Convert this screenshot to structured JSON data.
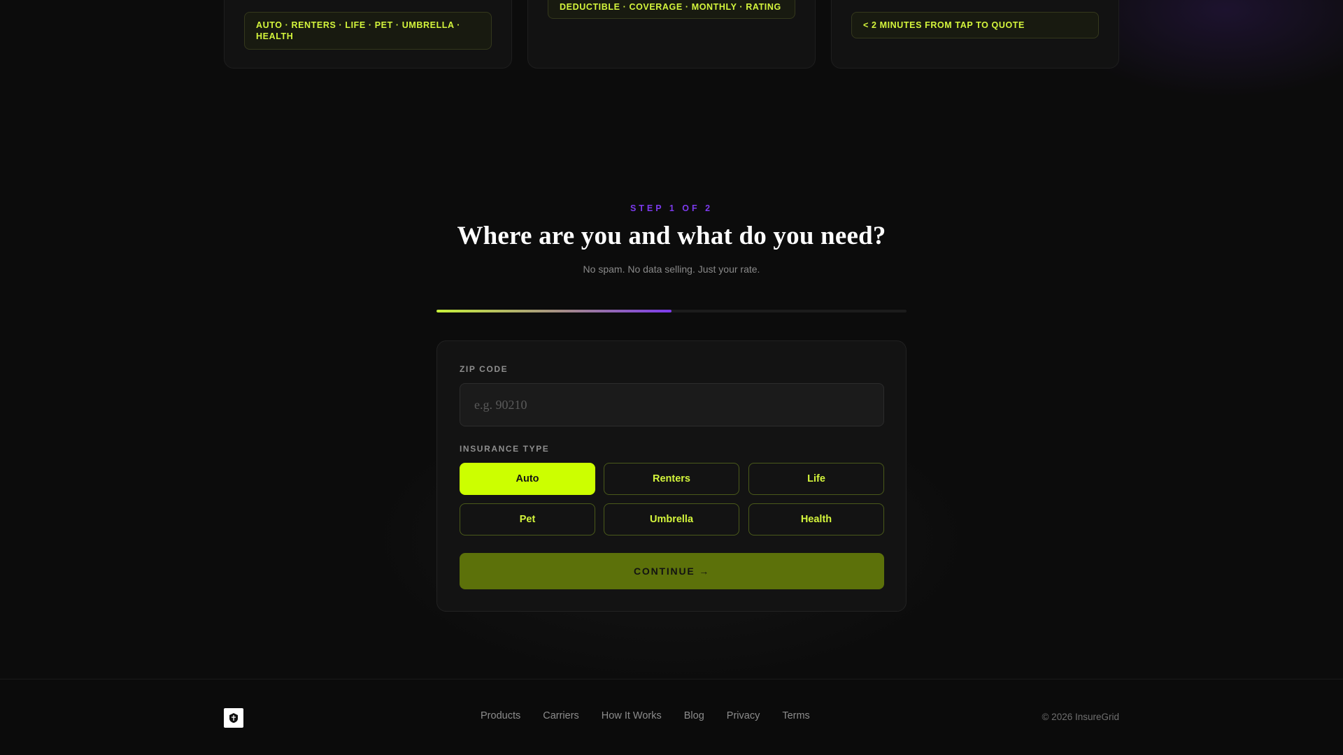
{
  "features": [
    {
      "pill": "AUTO · RENTERS · LIFE · PET · UMBRELLA · HEALTH"
    },
    {
      "pill": "DEDUCTIBLE · COVERAGE · MONTHLY · RATING"
    },
    {
      "pill": "< 2 MINUTES FROM TAP TO QUOTE"
    }
  ],
  "step": {
    "label": "STEP 1 OF 2",
    "title": "Where are you and what do you need?",
    "subtitle": "No spam. No data selling. Just your rate.",
    "progress": 0.5
  },
  "form": {
    "zip_label": "ZIP CODE",
    "zip_placeholder": "e.g. 90210",
    "zip_value": "",
    "type_label": "INSURANCE TYPE",
    "types": [
      "Auto",
      "Renters",
      "Life",
      "Pet",
      "Umbrella",
      "Health"
    ],
    "selected_type": "Auto",
    "continue_label": "CONTINUE →"
  },
  "footer": {
    "logo_icon": "shield-logo-icon",
    "links": [
      "Products",
      "Carriers",
      "How It Works",
      "Blog",
      "Privacy",
      "Terms"
    ],
    "copyright": "© 2026 InsureGrid"
  },
  "colors": {
    "accent": "#ccff00",
    "purple": "#7c3aed",
    "background": "#0c0c0c"
  }
}
